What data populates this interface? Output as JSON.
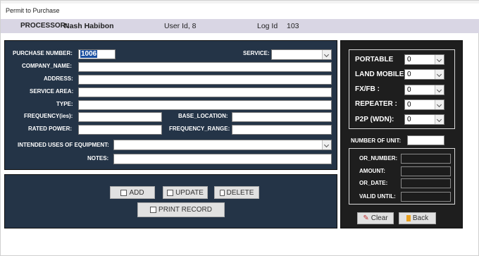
{
  "window": {
    "title": "Permit to Purchase"
  },
  "info": {
    "processor_label": "PROCESSOR:",
    "processor_name": "Nash Habibon",
    "user_id_text": "User Id, 8",
    "log_id_label": "Log Id",
    "log_id_value": "103"
  },
  "form": {
    "purchase_number_label": "PURCHASE NUMBER:",
    "purchase_number_value": "1006",
    "service_label": "SERVICE:",
    "service_value": "",
    "company_name_label": "COMPANY_NAME:",
    "address_label": "ADDRESS:",
    "service_area_label": "SERVICE AREA:",
    "type_label": "TYPE:",
    "frequency_label": "FREQUENCY(ies):",
    "base_location_label": "BASE_LOCATION:",
    "rated_power_label": "RATED POWER:",
    "frequency_range_label": "FREQUENCY_RANGE:",
    "intended_uses_label": "INTENDED USES OF EQUIPMENT:",
    "intended_uses_value": "",
    "notes_label": "NOTES:"
  },
  "actions": {
    "add": "ADD",
    "update": "UPDATE",
    "delete": "DELETE",
    "print": "PRINT RECORD"
  },
  "units": {
    "portable_label": "PORTABLE",
    "portable_value": "0",
    "land_mobile_label": "LAND MOBILE",
    "land_mobile_value": "0",
    "fxfb_label": "FX/FB :",
    "fxfb_value": "0",
    "repeater_label": "REPEATER :",
    "repeater_value": "0",
    "p2p_label": "P2P (WDN):",
    "p2p_value": "0",
    "number_of_unit_label": "NUMBER OF UNIT:"
  },
  "payment": {
    "or_number_label": "OR_NUMBER:",
    "amount_label": "AMOUNT:",
    "or_date_label": "OR_DATE:",
    "valid_until_label": "VALID UNTIL:"
  },
  "nav": {
    "clear": "Clear",
    "back": "Back"
  },
  "icons": {
    "add": "window-icon",
    "update": "window-icon",
    "delete": "trash-icon",
    "print": "document-icon",
    "clear": "eraser-icon",
    "back": "back-arrow-icon"
  }
}
